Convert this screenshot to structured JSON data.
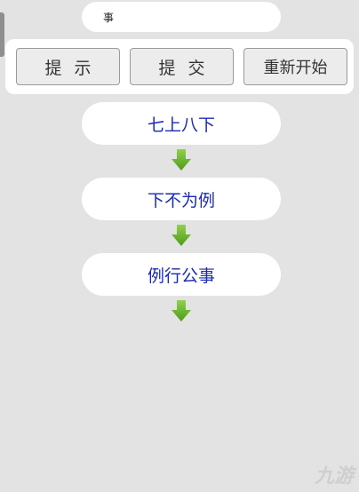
{
  "input": {
    "value": "事"
  },
  "buttons": {
    "hint_label": "提示",
    "submit_label": "提交",
    "restart_label": "重新开始"
  },
  "chain": [
    {
      "text": "七上八下"
    },
    {
      "text": "下不为例"
    },
    {
      "text": "例行公事"
    }
  ],
  "watermark": {
    "text": "九游"
  },
  "colors": {
    "background": "#e3e3e3",
    "chain_text": "#1a2ab8",
    "arrow_green": "#6bb528"
  },
  "icons": {
    "arrow": "green-down-arrow-icon",
    "watermark_logo": "jiuyou-logo-icon"
  }
}
